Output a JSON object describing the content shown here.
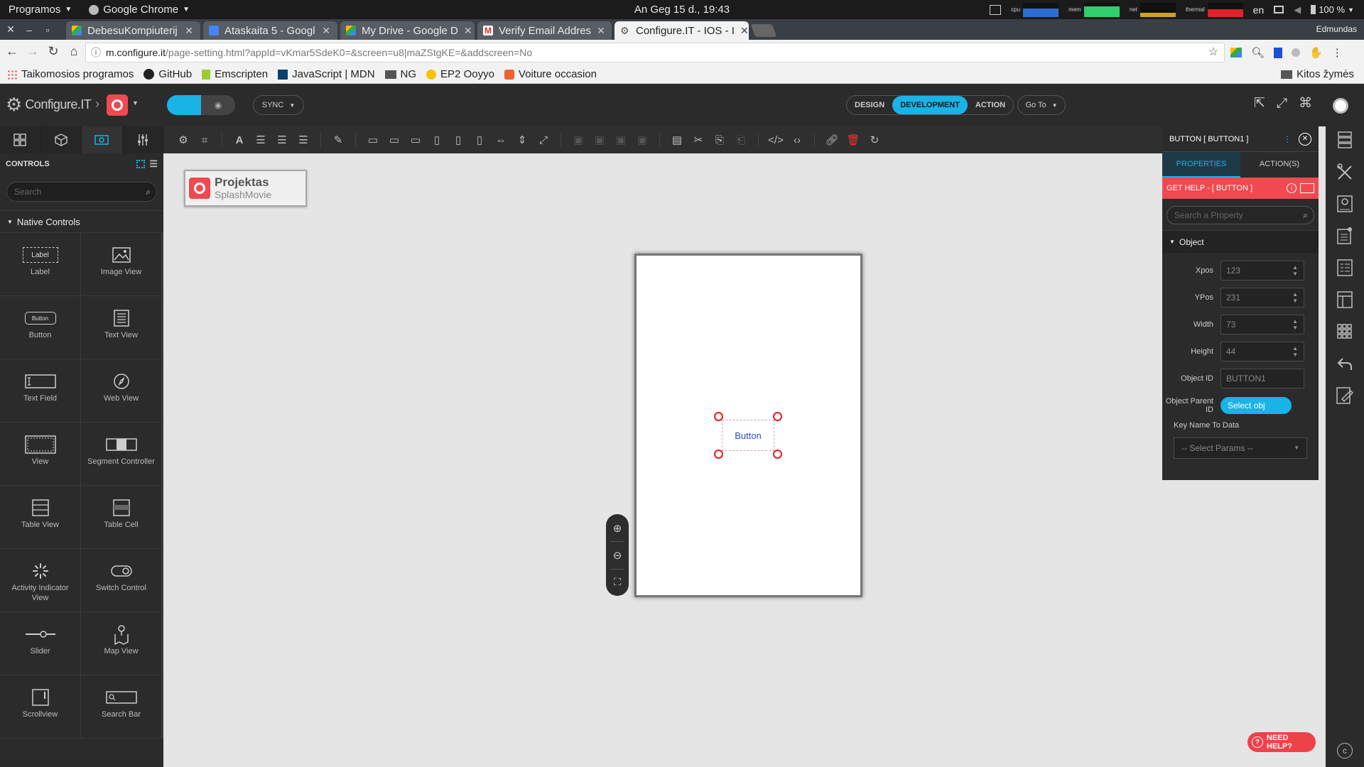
{
  "os": {
    "menu_apps": "Programos",
    "menu_chrome": "Google Chrome",
    "clock": "An Geg 15 d., 19:43",
    "lbl_cpu": "cpu",
    "lbl_mem": "mem",
    "lbl_net": "net",
    "lbl_thermal": "thermal",
    "lang": "en",
    "battery": "100 %"
  },
  "browser": {
    "profile": "Edmundas",
    "tabs": [
      {
        "label": "DebesuKompiuterij"
      },
      {
        "label": "Ataskaita 5 - Googl"
      },
      {
        "label": "My Drive - Google D"
      },
      {
        "label": "Verify Email Addres"
      },
      {
        "label": "Configure.IT - IOS - I"
      }
    ],
    "url_host": "m.configure.it",
    "url_path": "/page-setting.html?appId=vKmar5SdeK0=&screen=u8|maZStgKE=&addscreen=No",
    "bookmarks": [
      "Taikomosios programos",
      "GitHub",
      "Emscripten",
      "JavaScript | MDN",
      "NG",
      "EP2 Ooyyo",
      "Voiture occasion"
    ],
    "other_bookmarks": "Kitos žymės"
  },
  "app": {
    "logo_text": "Configure.IT",
    "sync": "SYNC",
    "modes": [
      "DESIGN",
      "DEVELOPMENT",
      "ACTION"
    ],
    "goto": "Go To"
  },
  "left": {
    "title": "CONTROLS",
    "search_placeholder": "Search",
    "section": "Native Controls",
    "controls": [
      {
        "label": "Label",
        "icon": "label-icon"
      },
      {
        "label": "Image View",
        "icon": "image-icon"
      },
      {
        "label": "Button",
        "icon": "button-icon"
      },
      {
        "label": "Text View",
        "icon": "text-view-icon"
      },
      {
        "label": "Text Field",
        "icon": "text-field-icon"
      },
      {
        "label": "Web View",
        "icon": "compass-icon"
      },
      {
        "label": "View",
        "icon": "view-icon"
      },
      {
        "label": "Segment Controller",
        "icon": "segment-icon"
      },
      {
        "label": "Table View",
        "icon": "table-icon"
      },
      {
        "label": "Table Cell",
        "icon": "table-cell-icon"
      },
      {
        "label": "Activity Indicator View",
        "icon": "spinner-icon"
      },
      {
        "label": "Switch Control",
        "icon": "switch-icon"
      },
      {
        "label": "Slider",
        "icon": "slider-icon"
      },
      {
        "label": "Map View",
        "icon": "map-icon"
      },
      {
        "label": "Scrollview",
        "icon": "scroll-icon"
      },
      {
        "label": "Search Bar",
        "icon": "search-bar-icon"
      }
    ],
    "label_icon_text": "Label",
    "button_icon_text": "Button"
  },
  "canvas": {
    "project_title": "Projektas",
    "project_sub": "SplashMovie",
    "button_text": "Button"
  },
  "props": {
    "title": "BUTTON [ BUTTON1 ]",
    "tab_properties": "PROPERTIES",
    "tab_actions": "ACTION(S)",
    "help": "GET HELP - [ BUTTON ]",
    "search_placeholder": "Search a Property",
    "section": "Object",
    "xpos_label": "Xpos",
    "xpos": "123",
    "ypos_label": "YPos",
    "ypos": "231",
    "width_label": "Width",
    "width": "73",
    "height_label": "Height",
    "height": "44",
    "objid_label": "Object ID",
    "objid": "BUTTON1",
    "parent_label": "Object Parent ID",
    "parent_btn": "Select obj",
    "keyname_label": "Key Name To Data",
    "params": "-- Select Params --"
  },
  "help_button": "NEED HELP?",
  "colors": {
    "accent": "#19b3e6",
    "brand_red": "#ef4a50"
  }
}
